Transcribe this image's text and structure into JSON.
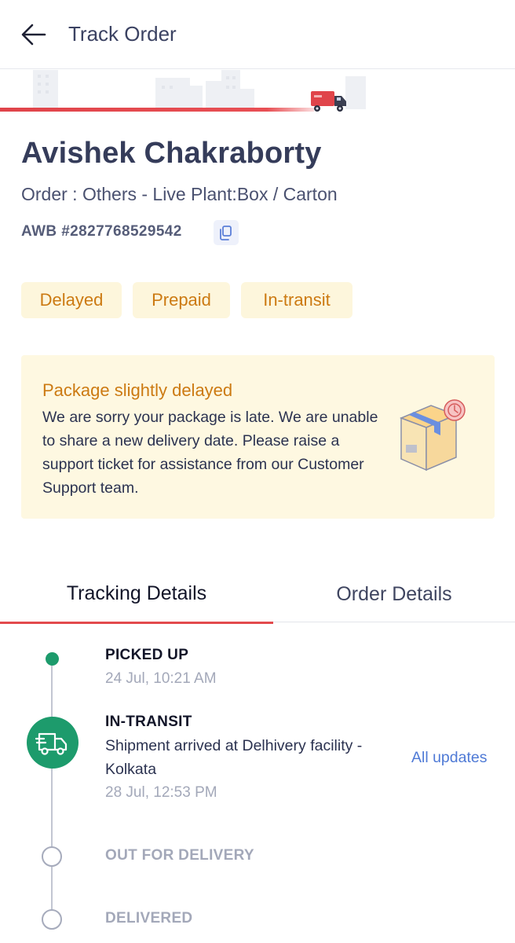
{
  "header": {
    "title": "Track Order"
  },
  "shipment": {
    "customer_name": "Avishek Chakraborty",
    "order_line": "Order : Others - Live Plant:Box / Carton",
    "awb": "AWB #2827768529542"
  },
  "chips": [
    "Delayed",
    "Prepaid",
    "In-transit"
  ],
  "delay_notice": {
    "title": "Package slightly delayed",
    "message": "We are sorry your package is late. We are unable to share a new delivery date. Please raise a support ticket for assistance from our Customer Support team."
  },
  "tabs": {
    "tracking": "Tracking Details",
    "order": "Order Details"
  },
  "timeline": [
    {
      "status": "PICKED UP",
      "time": "24 Jul, 10:21 AM"
    },
    {
      "status": "IN-TRANSIT",
      "message": "Shipment arrived at Delhivery facility - Kolkata",
      "time": "28 Jul, 12:53 PM"
    },
    {
      "status": "OUT FOR DELIVERY"
    },
    {
      "status": "DELIVERED"
    }
  ],
  "all_updates_label": "All updates",
  "colors": {
    "accent_red": "#e24a4d",
    "success_green": "#1d9b6c",
    "warning_orange": "#cc7a12",
    "chip_bg": "#fdf6dc",
    "link_blue": "#4f7ad6",
    "muted_text": "#a3a8b9"
  },
  "icons": [
    "back-arrow-icon",
    "copy-icon",
    "delayed-box-icon",
    "delivery-truck-icon"
  ]
}
